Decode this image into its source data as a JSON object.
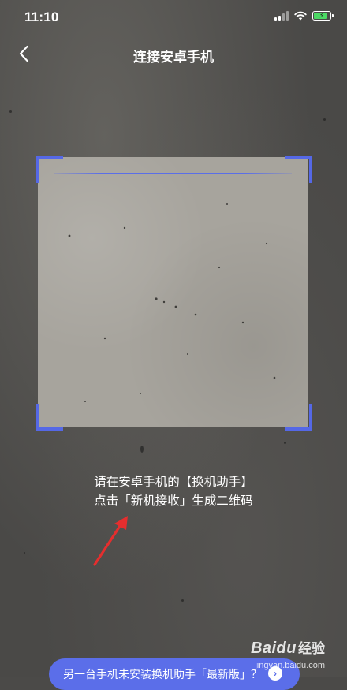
{
  "status_bar": {
    "time": "11:10",
    "icons": [
      "signal-icon",
      "wifi-icon",
      "battery-charging-icon"
    ],
    "battery_color": "#4cd964"
  },
  "nav": {
    "back_icon": "chevron-left-icon",
    "title": "连接安卓手机"
  },
  "scanner": {
    "accent_color": "#5568e6"
  },
  "instructions": {
    "line1": "请在安卓手机的【换机助手】",
    "line2": "点击「新机接收」生成二维码"
  },
  "annotation": {
    "arrow_color": "#e52e2e"
  },
  "bottom_banner": {
    "text": "另一台手机未安装换机助手「最新版」？",
    "icon": "chevron-right-icon",
    "color": "#5b6ee9"
  },
  "watermark": {
    "logo": "Baidu",
    "cn": "经验",
    "url": "jingyan.baidu.com"
  }
}
